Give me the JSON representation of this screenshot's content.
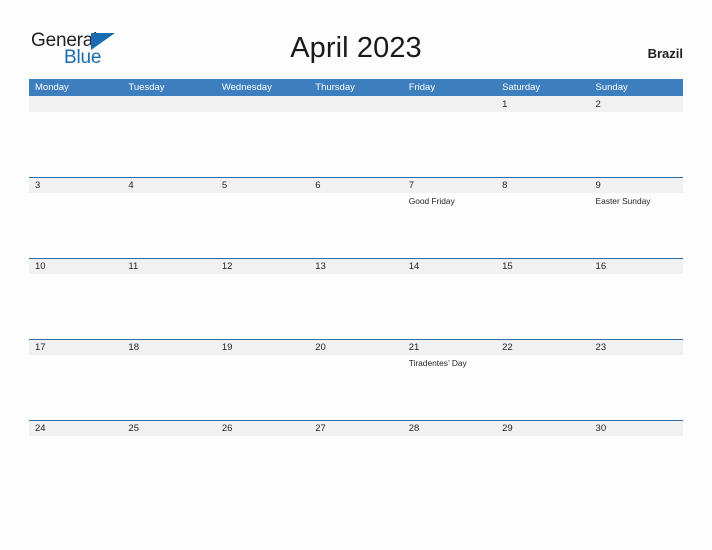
{
  "brand": {
    "name_top": "General",
    "name_bottom": "Blue",
    "triangle_icon": "triangle-icon",
    "accent_color": "#1a6cb0"
  },
  "header": {
    "title": "April 2023",
    "country": "Brazil"
  },
  "colors": {
    "weekday_header_bg": "#3d7ebf",
    "date_band_bg": "#f1f1f1",
    "row_border": "#2e6da4",
    "page_bg": "#fdfdfd",
    "text": "#231f20"
  },
  "calendar": {
    "weekdays": [
      "Monday",
      "Tuesday",
      "Wednesday",
      "Thursday",
      "Friday",
      "Saturday",
      "Sunday"
    ],
    "weeks": [
      {
        "days": [
          {
            "num": "",
            "events": []
          },
          {
            "num": "",
            "events": []
          },
          {
            "num": "",
            "events": []
          },
          {
            "num": "",
            "events": []
          },
          {
            "num": "",
            "events": []
          },
          {
            "num": "1",
            "events": []
          },
          {
            "num": "2",
            "events": []
          }
        ]
      },
      {
        "days": [
          {
            "num": "3",
            "events": []
          },
          {
            "num": "4",
            "events": []
          },
          {
            "num": "5",
            "events": []
          },
          {
            "num": "6",
            "events": []
          },
          {
            "num": "7",
            "events": [
              "Good Friday"
            ]
          },
          {
            "num": "8",
            "events": []
          },
          {
            "num": "9",
            "events": [
              "Easter Sunday"
            ]
          }
        ]
      },
      {
        "days": [
          {
            "num": "10",
            "events": []
          },
          {
            "num": "11",
            "events": []
          },
          {
            "num": "12",
            "events": []
          },
          {
            "num": "13",
            "events": []
          },
          {
            "num": "14",
            "events": []
          },
          {
            "num": "15",
            "events": []
          },
          {
            "num": "16",
            "events": []
          }
        ]
      },
      {
        "days": [
          {
            "num": "17",
            "events": []
          },
          {
            "num": "18",
            "events": []
          },
          {
            "num": "19",
            "events": []
          },
          {
            "num": "20",
            "events": []
          },
          {
            "num": "21",
            "events": [
              "Tiradentes’ Day"
            ]
          },
          {
            "num": "22",
            "events": []
          },
          {
            "num": "23",
            "events": []
          }
        ]
      },
      {
        "days": [
          {
            "num": "24",
            "events": []
          },
          {
            "num": "25",
            "events": []
          },
          {
            "num": "26",
            "events": []
          },
          {
            "num": "27",
            "events": []
          },
          {
            "num": "28",
            "events": []
          },
          {
            "num": "29",
            "events": []
          },
          {
            "num": "30",
            "events": []
          }
        ]
      }
    ]
  }
}
